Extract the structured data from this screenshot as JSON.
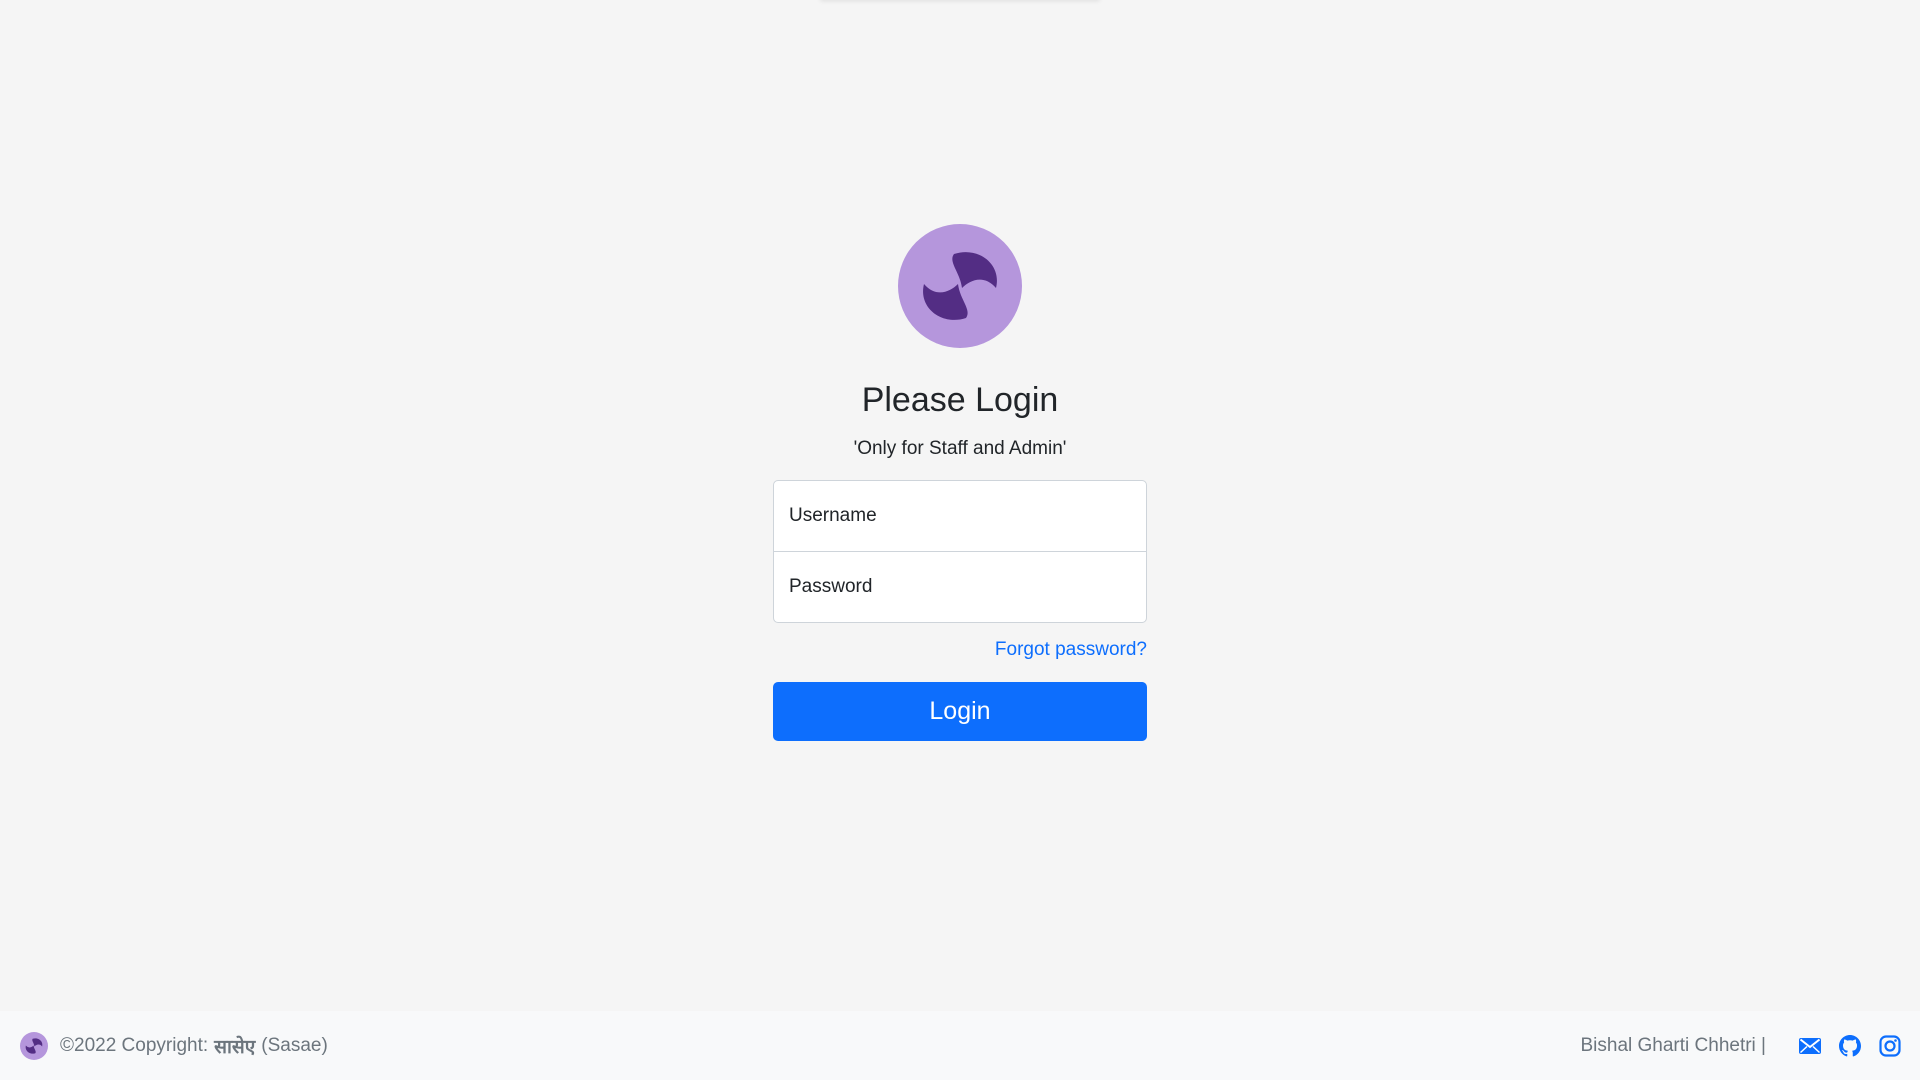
{
  "login": {
    "heading": "Please Login",
    "subheading": "'Only for Staff and Admin'",
    "username_placeholder": "Username",
    "password_placeholder": "Password",
    "forgot_label": "Forgot password?",
    "login_label": "Login",
    "logo_icon": "sasae-logo-icon"
  },
  "footer": {
    "copyright_prefix": "©2022 Copyright:",
    "brand_native": "सासेए",
    "brand_latin": "(Sasae)",
    "author": "Bishal Gharti Chhetri |",
    "icons": [
      "mail-icon",
      "github-icon",
      "instagram-icon"
    ]
  },
  "colors": {
    "background": "#f5f5f5",
    "primary": "#0d6efd",
    "logo_light": "#b596dc",
    "logo_dark": "#532d84",
    "footer_bg": "#f8f9fa",
    "muted_text": "#6c757d"
  }
}
